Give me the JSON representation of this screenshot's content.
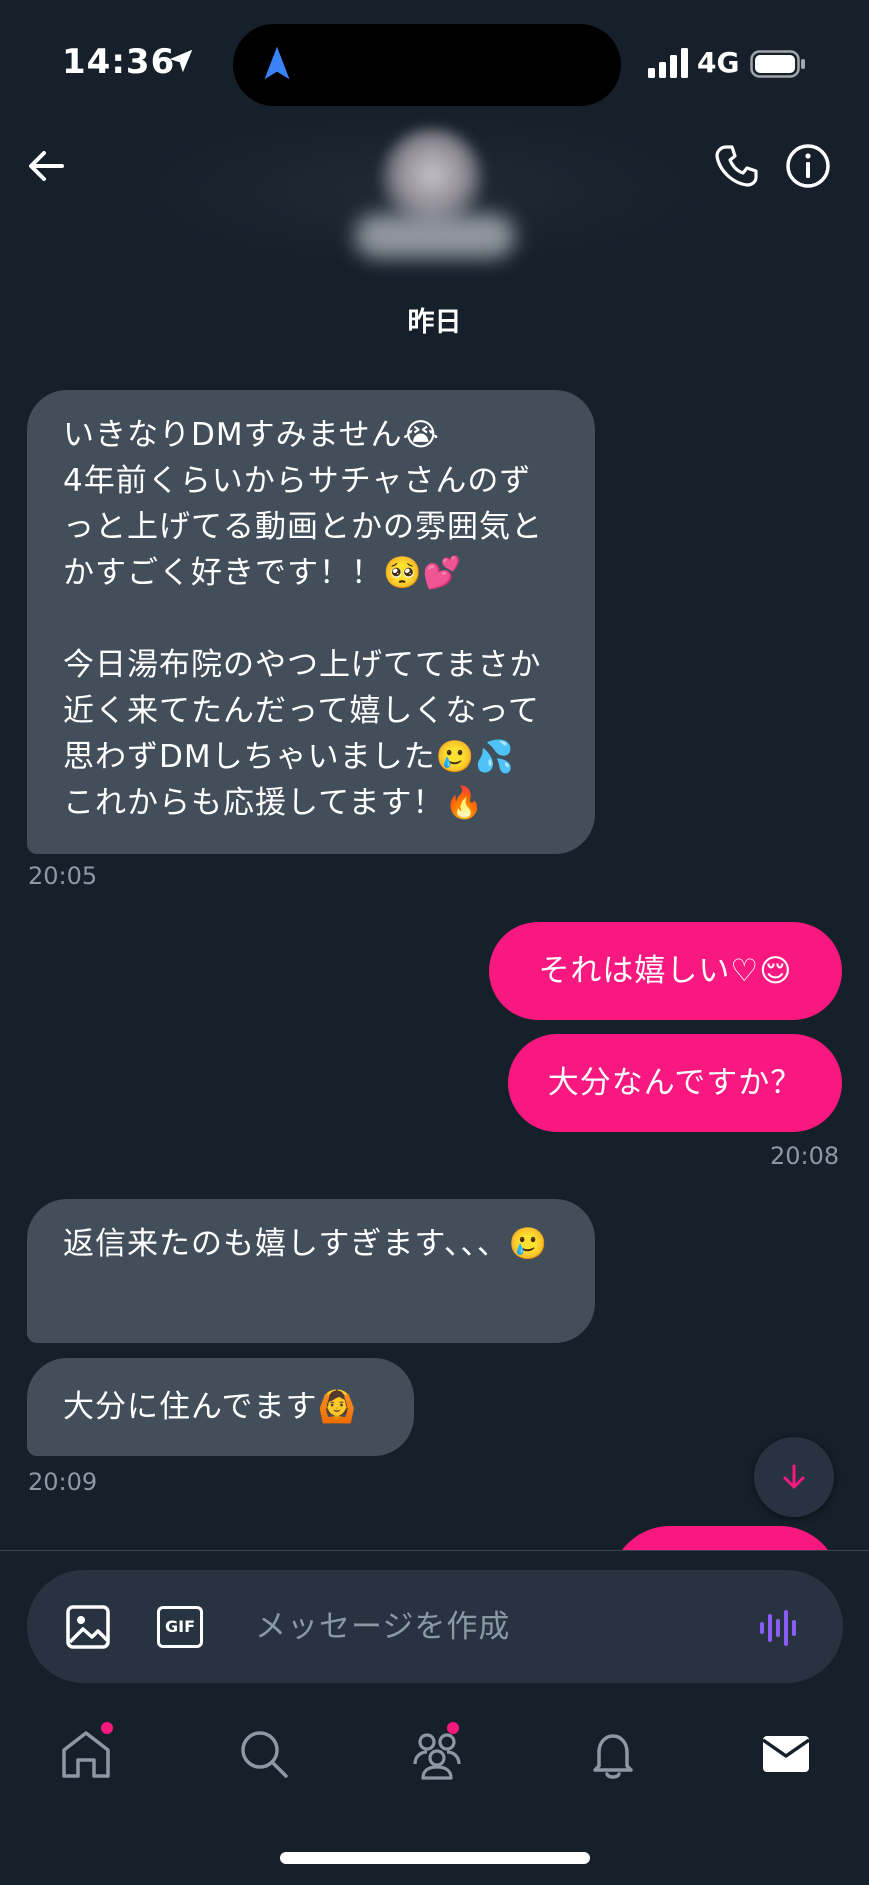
{
  "status_bar": {
    "time": "14:36",
    "network": "4G"
  },
  "header": {
    "back_icon": "arrow-left-icon",
    "call_icon": "phone-icon",
    "info_icon": "info-icon"
  },
  "conversation": {
    "date_separator": "昨日",
    "messages": [
      {
        "direction": "incoming",
        "text": "いきなりDMすみません😭\n4年前くらいからサチャさんのずっと上げてる動画とかの雰囲気とかすごく好きです！！🥺💕\n\n今日湯布院のやつ上げててまさか近く来てたんだって嬉しくなって思わずDMしちゃいました🥲💦\nこれからも応援してます！🔥"
      },
      {
        "direction": "incoming_time",
        "text": "20:05"
      },
      {
        "direction": "outgoing",
        "text": "それは嬉しい♡😌"
      },
      {
        "direction": "outgoing",
        "text": "大分なんですか？"
      },
      {
        "direction": "outgoing_time",
        "text": "20:08"
      },
      {
        "direction": "incoming",
        "text": "返信来たのも嬉しすぎます、、、🥲"
      },
      {
        "direction": "incoming",
        "text": "大分に住んでます🙆"
      },
      {
        "direction": "incoming_time",
        "text": "20:09"
      }
    ]
  },
  "composer": {
    "placeholder": "メッセージを作成",
    "gif_label": "GIF"
  },
  "tab_bar": [
    "home",
    "search",
    "communities",
    "notifications",
    "messages"
  ],
  "colors": {
    "background": "#15202b",
    "incoming_bubble": "#434e5b",
    "outgoing_bubble": "#f91880",
    "accent": "#1d9bf0"
  }
}
